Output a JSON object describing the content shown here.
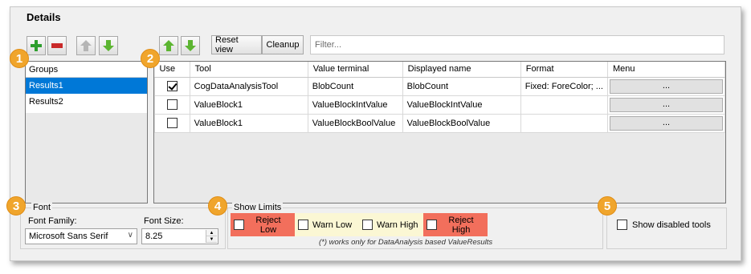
{
  "title": "Details",
  "toolbar": {
    "reset_view_label": "Reset view",
    "cleanup_label": "Cleanup",
    "filter_placeholder": "Filter..."
  },
  "groups": {
    "header": "Groups",
    "items": [
      "Results1",
      "Results2"
    ],
    "selected_index": 0
  },
  "grid": {
    "columns": [
      "Use",
      "Tool",
      "Value terminal",
      "Displayed name",
      "Format",
      "Menu"
    ],
    "rows": [
      {
        "use": true,
        "tool": "CogDataAnalysisTool",
        "value_terminal": "BlobCount",
        "displayed_name": "BlobCount",
        "format": "Fixed: ForeColor; ...",
        "menu": "..."
      },
      {
        "use": false,
        "tool": "ValueBlock1",
        "value_terminal": "ValueBlockIntValue",
        "displayed_name": "ValueBlockIntValue",
        "format": "",
        "menu": "..."
      },
      {
        "use": false,
        "tool": "ValueBlock1",
        "value_terminal": "ValueBlockBoolValue",
        "displayed_name": "ValueBlockBoolValue",
        "format": "",
        "menu": "..."
      }
    ]
  },
  "font": {
    "group_label": "Font",
    "family_label": "Font Family:",
    "family_value": "Microsoft Sans Serif",
    "size_label": "Font Size:",
    "size_value": "8.25"
  },
  "limits": {
    "group_label": "Show Limits",
    "reject_low": "Reject Low",
    "warn_low": "Warn Low",
    "warn_high": "Warn High",
    "reject_high": "Reject High",
    "note": "(*) works only for DataAnalysis based ValueResults"
  },
  "options": {
    "show_disabled_tools": "Show disabled tools"
  },
  "badges": [
    "1",
    "2",
    "3",
    "4",
    "5"
  ],
  "colors": {
    "badge": "#f0a52c",
    "selection": "#0078d7",
    "reject": "#f26f5c",
    "warn": "#fbf7d4",
    "add": "#2e9e2e",
    "remove": "#c92a2a"
  },
  "icons": [
    "add-icon",
    "remove-icon",
    "arrow-up-icon",
    "arrow-down-icon",
    "checkbox-icon",
    "dropdown-arrow-icon",
    "spin-up-icon",
    "spin-down-icon"
  ]
}
